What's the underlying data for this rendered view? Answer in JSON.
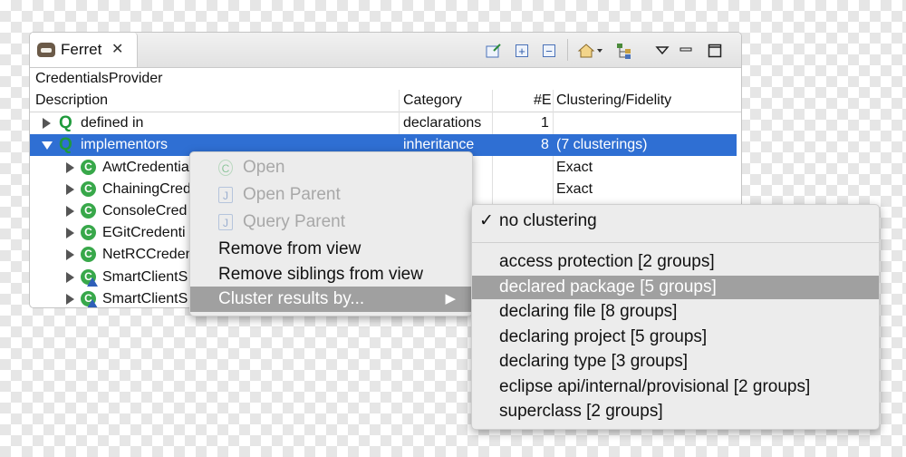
{
  "view": {
    "tab_label": "Ferret",
    "breadcrumb": "CredentialsProvider",
    "columns": [
      "Description",
      "Category",
      "#E",
      "Clustering/Fidelity"
    ],
    "rows": [
      {
        "label": "defined in",
        "category": "declarations",
        "count": "1",
        "fidelity": ""
      },
      {
        "label": "implementors",
        "category": "inheritance",
        "count": "8",
        "fidelity": "(7 clusterings)"
      },
      {
        "label": "AwtCredentia",
        "category": "",
        "count": "",
        "fidelity": "Exact"
      },
      {
        "label": "ChainingCred",
        "category": "",
        "count": "",
        "fidelity": "Exact"
      },
      {
        "label": "ConsoleCred",
        "category": "",
        "count": "",
        "fidelity": ""
      },
      {
        "label": "EGitCredenti",
        "category": "",
        "count": "",
        "fidelity": ""
      },
      {
        "label": "NetRCCreden",
        "category": "",
        "count": "",
        "fidelity": ""
      },
      {
        "label": "SmartClientS",
        "category": "",
        "count": "",
        "fidelity": ""
      },
      {
        "label": "SmartClientS",
        "category": "",
        "count": "",
        "fidelity": ""
      }
    ]
  },
  "context_menu": {
    "items": [
      {
        "label": "Open"
      },
      {
        "label": "Open Parent"
      },
      {
        "label": "Query Parent"
      },
      {
        "label": "Remove from view"
      },
      {
        "label": "Remove siblings from view"
      },
      {
        "label": "Cluster results by...",
        "arrow": "▶"
      }
    ]
  },
  "submenu": {
    "checked_item": "no clustering",
    "check_mark": "✓",
    "items": [
      "access protection [2 groups]",
      "declared package [5 groups]",
      "declaring file [8 groups]",
      "declaring project [5 groups]",
      "declaring type [3 groups]",
      "eclipse api/internal/provisional [2 groups]",
      "superclass [2 groups]"
    ]
  },
  "colors": {
    "selection": "#2f6fd3",
    "menu_highlight": "#a0a0a0",
    "class_icon": "#38a84a"
  },
  "icons": [
    "view-icon",
    "close-icon",
    "pin-icon",
    "expand-all-icon",
    "collapse-all-icon",
    "home-icon",
    "hierarchy-icon",
    "view-menu-icon",
    "minimize-icon",
    "maximize-icon"
  ]
}
